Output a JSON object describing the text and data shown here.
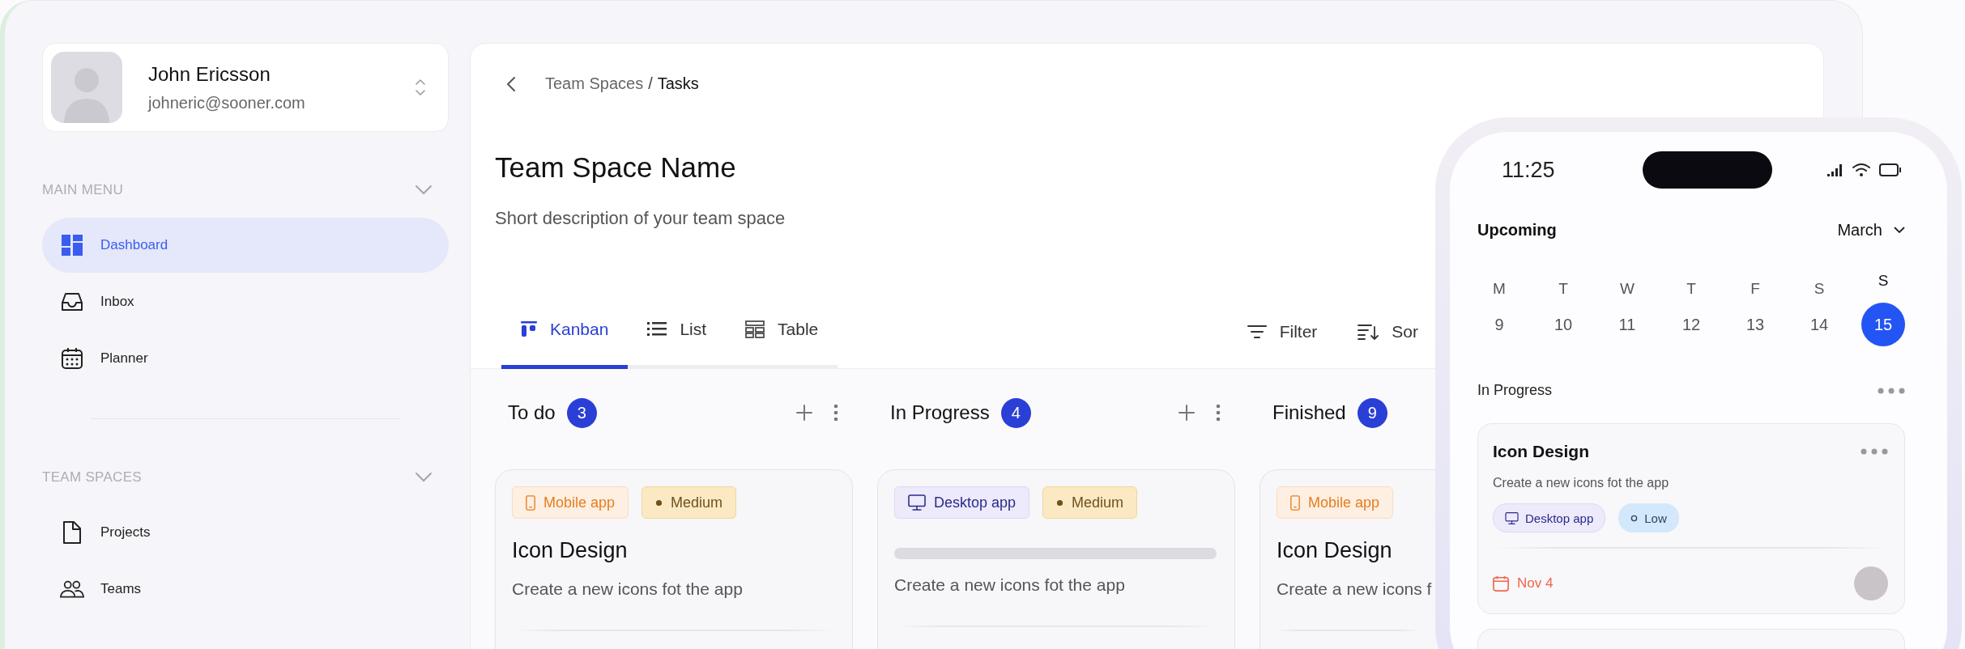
{
  "profile": {
    "name": "John Ericsson",
    "email": "johneric@sooner.com"
  },
  "sidebar": {
    "sections": [
      {
        "title": "MAIN MENU",
        "items": [
          {
            "label": "Dashboard",
            "selected": true
          },
          {
            "label": "Inbox",
            "selected": false
          },
          {
            "label": "Planner",
            "selected": false
          }
        ]
      },
      {
        "title": "TEAM SPACES",
        "items": [
          {
            "label": "Projects",
            "selected": false
          },
          {
            "label": "Teams",
            "selected": false
          }
        ]
      }
    ]
  },
  "breadcrumb": {
    "parent": "Team Spaces",
    "separator": "/",
    "current": "Tasks"
  },
  "header": {
    "title": "Team Space Name",
    "description": "Short description of your team space"
  },
  "view_tabs": [
    {
      "label": "Kanban",
      "selected": true
    },
    {
      "label": "List",
      "selected": false
    },
    {
      "label": "Table",
      "selected": false
    }
  ],
  "tools": [
    {
      "label": "Filter"
    },
    {
      "label": "Sor"
    }
  ],
  "columns": [
    {
      "title": "To do",
      "count": "3",
      "actions": true,
      "cards": [
        {
          "kind": "task",
          "tags": [
            {
              "label": "Mobile app",
              "kind": "mobile"
            },
            {
              "label": "Medium",
              "kind": "medium"
            }
          ],
          "title": "Icon Design",
          "description": "Create a new icons fot the app"
        }
      ]
    },
    {
      "title": "In Progress",
      "count": "4",
      "actions": true,
      "cards": [
        {
          "kind": "skeleton",
          "tags": [
            {
              "label": "Desktop app",
              "kind": "desktop"
            },
            {
              "label": "Medium",
              "kind": "medium"
            }
          ],
          "description": "Create a new icons fot the app"
        }
      ]
    },
    {
      "title": "Finished",
      "count": "9",
      "actions": false,
      "cards": [
        {
          "kind": "task",
          "tags": [
            {
              "label": "Mobile app",
              "kind": "mobile"
            }
          ],
          "title": "Icon Design",
          "description": "Create a new icons f"
        }
      ]
    }
  ],
  "phone": {
    "time": "11:25",
    "title": "Upcoming",
    "month": "March",
    "week": [
      {
        "day": "M",
        "date": "9",
        "selected": false
      },
      {
        "day": "T",
        "date": "10",
        "selected": false
      },
      {
        "day": "W",
        "date": "11",
        "selected": false
      },
      {
        "day": "T",
        "date": "12",
        "selected": false
      },
      {
        "day": "F",
        "date": "13",
        "selected": false
      },
      {
        "day": "S",
        "date": "14",
        "selected": false
      },
      {
        "day": "S",
        "date": "15",
        "selected": true
      }
    ],
    "group": "In Progress",
    "task": {
      "title": "Icon Design",
      "description": "Create a new icons fot the app",
      "tags": [
        {
          "label": "Desktop app",
          "kind": "desktop"
        },
        {
          "label": "Low",
          "kind": "low"
        }
      ],
      "due": "Nov 4"
    }
  }
}
